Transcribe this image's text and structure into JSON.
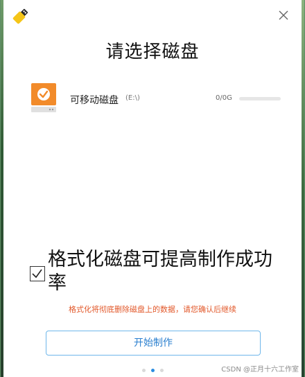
{
  "window": {
    "title": "请选择磁盘"
  },
  "disk": {
    "name": "可移动磁盘",
    "letter": "(E:\\)",
    "size": "0/0G",
    "usage_fraction": 0
  },
  "format": {
    "checked": true,
    "label": "格式化磁盘可提高制作成功率",
    "warning": "格式化将彻底删除磁盘上的数据，请您确认后继续"
  },
  "actions": {
    "start_label": "开始制作"
  },
  "pager": {
    "count": 3,
    "active_index": 1
  },
  "watermark": "CSDN @正月十六工作室",
  "colors": {
    "accent": "#2a8ce0",
    "warning": "#e2582a",
    "disk_icon": "#f28b2a"
  },
  "icons": {
    "app": "usb-stick-icon",
    "close": "close-icon",
    "disk": "removable-disk-icon",
    "check": "checkmark-icon"
  }
}
